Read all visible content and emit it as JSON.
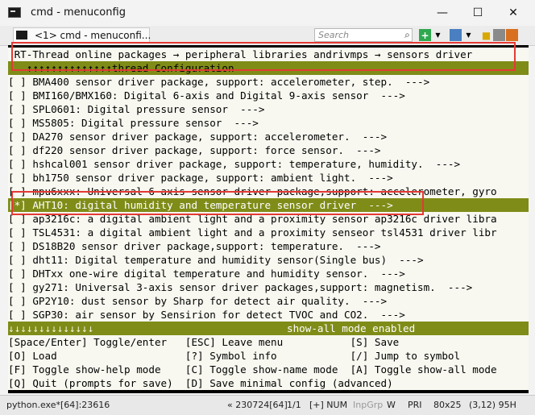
{
  "window": {
    "title": "cmd - menuconfig"
  },
  "tab": {
    "label": "<1> cmd - menuconfi..."
  },
  "toolbar": {
    "search_placeholder": "Search"
  },
  "breadcrumb": "RT-Thread online packages → peripheral libraries andrivmps → sensors driver",
  "header_sub": "↑↑↑↑↑↑↑↑↑↑↑↑↑↑thread Configuration",
  "items": [
    "[ ] BMA400 sensor driver package, support: accelerometer, step.  --->",
    "[ ] BMI160/BMX160: Digital 6-axis and Digital 9-axis sensor  --->",
    "[ ] SPL0601: Digital pressure sensor  --->",
    "[ ] MS5805: Digital pressure sensor  --->",
    "[ ] DA270 sensor driver package, support: accelerometer.  --->",
    "[ ] df220 sensor driver package, support: force sensor.  --->",
    "[ ] hshcal001 sensor driver package, support: temperature, humidity.  --->",
    "[ ] bh1750 sensor driver package, support: ambient light.  --->",
    "[ ] mpu6xxx: Universal 6-axis sensor driver package,support: accelerometer, gyro",
    "[*] AHT10: digital humidity and temperature sensor driver  --->",
    "[ ] ap3216c: a digital ambient light and a proximity sensor ap3216c driver libra",
    "[ ] TSL4531: a digital ambient light and a proximity senseor tsl4531 driver libr",
    "[ ] DS18B20 sensor driver package,support: temperature.  --->",
    "[ ] dht11: Digital temperature and humidity sensor(Single bus)  --->",
    "[ ] DHTxx one-wire digital temperature and humidity sensor.  --->",
    "[ ] gy271: Universal 3-axis sensor driver packages,support: magnetism.  --->",
    "[ ] GP2Y10: dust sensor by Sharp for detect air quality.  --->",
    "[ ] SGP30: air sensor by Sensirion for detect TVOC and CO2.  --->"
  ],
  "footer_bar": {
    "arrows": "↓↓↓↓↓↓↓↓↓↓↓↓↓↓",
    "mode": "show-all mode enabled"
  },
  "help_lines": [
    "[Space/Enter] Toggle/enter   [ESC] Leave menu           [S] Save",
    "[O] Load                     [?] Symbol info            [/] Jump to symbol",
    "[F] Toggle show-help mode    [C] Toggle show-name mode  [A] Toggle show-all mode",
    "[Q] Quit (prompts for save)  [D] Save minimal config (advanced)"
  ],
  "status": {
    "process": "python.exe*[64]:23616",
    "build": "« 230724[64]",
    "pos": "1/1",
    "num": "[+] NUM",
    "inpgrp": "InpGrp",
    "w": "W",
    "pri": "PRI",
    "size": "80x25",
    "cursor": "(3,12) 95H"
  },
  "colors": {
    "terminal_bg": "#000000",
    "dialog_bg": "#f8f8f0",
    "highlight_bar": "#7f8c18",
    "annotation_red": "#e53935"
  }
}
